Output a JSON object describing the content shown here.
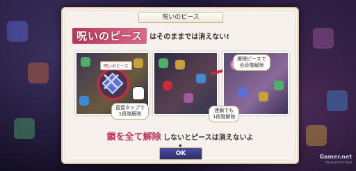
{
  "dialog": {
    "title": "呪いのピース",
    "headline_key": "呪いのピース",
    "headline_rest": "はそのままでは消えない!",
    "panels": [
      {
        "tag": "呪いのピース",
        "callout": "直接タップで\n1段階解除"
      },
      {
        "callout": "連鎖でも\n1段階解除"
      },
      {
        "callout": "爆弾ピースで\n全段階解除"
      }
    ],
    "note_key": "鎖を全て解除",
    "note_rest": "しないとピースは消えないよ",
    "ok_label": "OK"
  },
  "watermark": {
    "brand": "Gamer.net",
    "sub": "Development Build"
  },
  "colors": {
    "accent": "#c0305a",
    "button": "#2e2f70",
    "dialog_bg": "#f6f1ec"
  },
  "icons": [
    "lock-chain-icon",
    "tap-hand-icon",
    "arrow-right-icon",
    "sparkle-icon"
  ]
}
